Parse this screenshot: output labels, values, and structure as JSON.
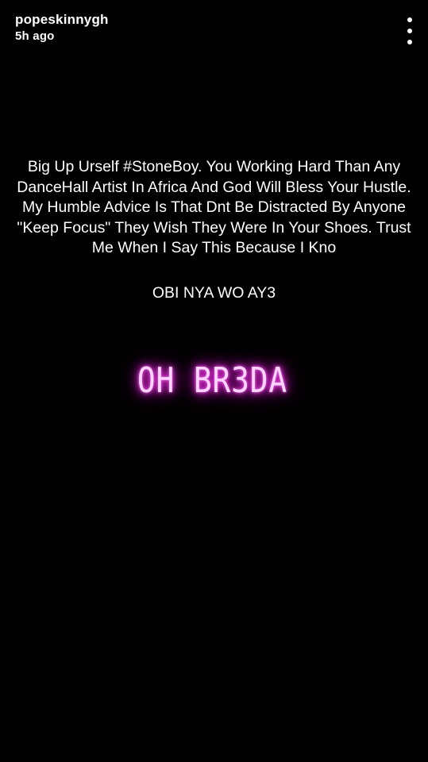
{
  "header": {
    "username": "popeskinnygh",
    "timestamp": "5h ago"
  },
  "menu": {
    "icon": "more-vertical-icon"
  },
  "caption": {
    "body": "Big Up Urself #StoneBoy. You Working Hard Than Any DanceHall Artist In Africa And God Will Bless Your Hustle. My Humble Advice Is That Dnt Be Distracted By Anyone \"Keep Focus\" They Wish They Were In Your Shoes. Trust Me When I Say This Because I Kno",
    "subline": "OBI NYA WO AY3"
  },
  "sticker": {
    "text": "OH BR3DA",
    "glow_color": "#ff33ee"
  },
  "colors": {
    "background": "#000000",
    "text": "#ffffff"
  }
}
